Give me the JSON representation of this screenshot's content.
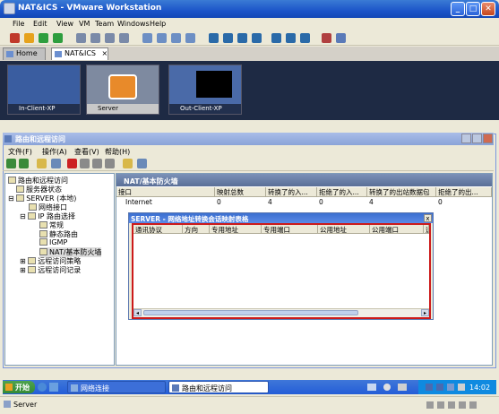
{
  "vmware": {
    "title": "NAT&ICS - VMware Workstation",
    "menu": [
      "File",
      "Edit",
      "View",
      "VM",
      "Team",
      "Windows",
      "Help"
    ],
    "tabs": [
      {
        "label": "Home",
        "active": false
      },
      {
        "label": "NAT&ICS",
        "active": true
      }
    ],
    "thumbnails": [
      {
        "label": "In-Client-XP"
      },
      {
        "label": "Server"
      },
      {
        "label": "Out-Client-XP"
      }
    ],
    "status": "Server"
  },
  "rras": {
    "title": "路由和远程访问",
    "menu": [
      "文件(F)",
      "操作(A)",
      "查看(V)",
      "帮助(H)"
    ],
    "tree": [
      {
        "label": "路由和远程访问",
        "level": 0
      },
      {
        "label": "服务器状态",
        "level": 1
      },
      {
        "label": "SERVER (本地)",
        "level": 1
      },
      {
        "label": "网络接口",
        "level": 2
      },
      {
        "label": "IP 路由选择",
        "level": 2
      },
      {
        "label": "常规",
        "level": 3
      },
      {
        "label": "静态路由",
        "level": 3
      },
      {
        "label": "IGMP",
        "level": 3
      },
      {
        "label": "NAT/基本防火墙",
        "level": 3
      },
      {
        "label": "远程访问策略",
        "level": 2
      },
      {
        "label": "远程访问记录",
        "level": 2
      }
    ],
    "detail_header": "NAT/基本防火墙",
    "columns": [
      "接口",
      "映射总数",
      "转换了的入...",
      "拒绝了的入...",
      "转换了的出站数据包",
      "拒绝了的出..."
    ],
    "rows": [
      [
        "Internet",
        "0",
        "4",
        "0",
        "4",
        "0"
      ]
    ]
  },
  "popup": {
    "title": "SERVER - 网络地址转换会话映射表格",
    "close": "x",
    "columns": [
      "通讯协议",
      "方向",
      "专用地址",
      "专用端口",
      "公用地址",
      "公用端口",
      "远"
    ]
  },
  "taskbar": {
    "start": "开始",
    "tasks": [
      {
        "label": "网络连接",
        "active": false
      },
      {
        "label": "路由和远程访问",
        "active": true
      }
    ],
    "clock": "14:02"
  }
}
